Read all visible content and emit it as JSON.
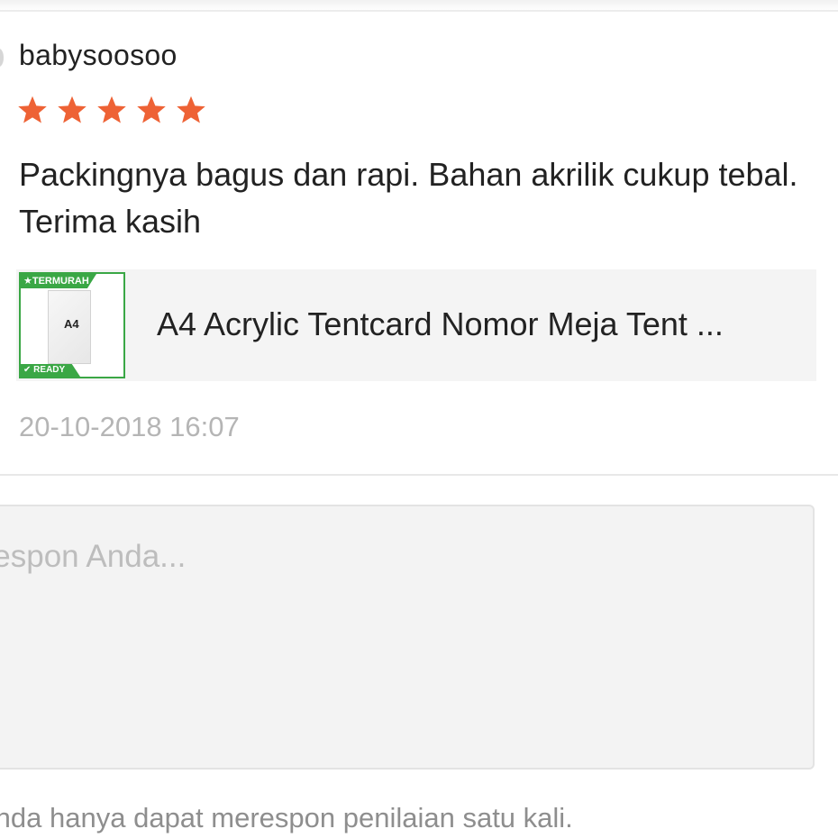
{
  "review": {
    "username": "babysoosoo",
    "rating": 5,
    "rating_max": 5,
    "star_color": "#ee6235",
    "text": "Packingnya bagus dan rapi. Bahan akrilik cukup tebal. Terima kasih",
    "timestamp": "20-10-2018 16:07"
  },
  "product": {
    "thumbnail": {
      "badge_top": "TERMURAH",
      "badge_bottom": "READY",
      "size_label": "A4",
      "accent_color": "#3aa745"
    },
    "name": "A4 Acrylic Tentcard Nomor Meja Tent ..."
  },
  "response": {
    "placeholder": "Respon Anda...",
    "value": ""
  },
  "note": "Anda hanya dapat merespon penilaian satu kali."
}
